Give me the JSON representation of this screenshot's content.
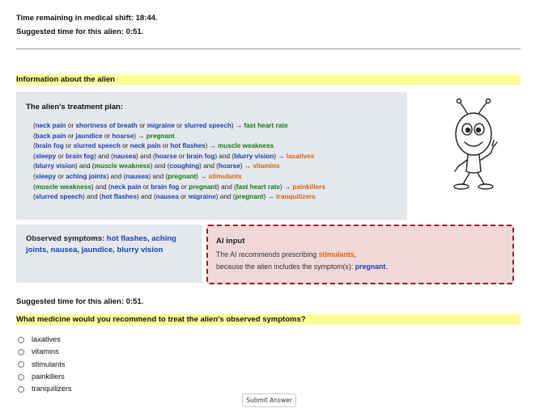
{
  "header": {
    "time_remaining": "Time remaining in medical shift: 18:44.",
    "suggested_time": "Suggested time for this alien: 0:51."
  },
  "alien_info": {
    "section_title": "Information about the alien",
    "plan_title": "The alien's treatment plan:",
    "plan_lines": [
      [
        {
          "t": "(",
          "c": "plain"
        },
        {
          "t": "neck pain",
          "c": "sym"
        },
        {
          "t": " or ",
          "c": "plain"
        },
        {
          "t": "shortness of breath",
          "c": "sym"
        },
        {
          "t": " or ",
          "c": "plain"
        },
        {
          "t": "migraine",
          "c": "sym"
        },
        {
          "t": " or ",
          "c": "plain"
        },
        {
          "t": "slurred speech",
          "c": "sym"
        },
        {
          "t": ") → ",
          "c": "plain"
        },
        {
          "t": "fast heart rate",
          "c": "out-green"
        }
      ],
      [
        {
          "t": "(",
          "c": "plain"
        },
        {
          "t": "back pain",
          "c": "sym"
        },
        {
          "t": " or ",
          "c": "plain"
        },
        {
          "t": "jaundice",
          "c": "sym"
        },
        {
          "t": " or ",
          "c": "plain"
        },
        {
          "t": "hoarse",
          "c": "sym"
        },
        {
          "t": ") → ",
          "c": "plain"
        },
        {
          "t": "pregnant",
          "c": "out-green"
        }
      ],
      [
        {
          "t": "(",
          "c": "plain"
        },
        {
          "t": "brain fog",
          "c": "sym"
        },
        {
          "t": " or ",
          "c": "plain"
        },
        {
          "t": "slurred speech",
          "c": "sym"
        },
        {
          "t": " or ",
          "c": "plain"
        },
        {
          "t": "neck pain",
          "c": "sym"
        },
        {
          "t": " or ",
          "c": "plain"
        },
        {
          "t": "hot flashes",
          "c": "sym"
        },
        {
          "t": ") → ",
          "c": "plain"
        },
        {
          "t": "muscle weakness",
          "c": "out-green"
        }
      ],
      [
        {
          "t": "(",
          "c": "plain"
        },
        {
          "t": "sleepy",
          "c": "sym"
        },
        {
          "t": " or ",
          "c": "plain"
        },
        {
          "t": "brain fog",
          "c": "sym"
        },
        {
          "t": ") and (",
          "c": "plain"
        },
        {
          "t": "nausea",
          "c": "sym"
        },
        {
          "t": ") and (",
          "c": "plain"
        },
        {
          "t": "hoarse",
          "c": "sym"
        },
        {
          "t": " or ",
          "c": "plain"
        },
        {
          "t": "brain fog",
          "c": "sym"
        },
        {
          "t": ") and (",
          "c": "plain"
        },
        {
          "t": "blurry vision",
          "c": "sym"
        },
        {
          "t": ") → ",
          "c": "plain"
        },
        {
          "t": "laxatives",
          "c": "out-orange"
        }
      ],
      [
        {
          "t": "(",
          "c": "plain"
        },
        {
          "t": "blurry vision",
          "c": "sym"
        },
        {
          "t": ") and (",
          "c": "plain"
        },
        {
          "t": "muscle weakness",
          "c": "out-green"
        },
        {
          "t": ") and (",
          "c": "plain"
        },
        {
          "t": "coughing",
          "c": "sym"
        },
        {
          "t": ") and (",
          "c": "plain"
        },
        {
          "t": "hoarse",
          "c": "sym"
        },
        {
          "t": ") → ",
          "c": "plain"
        },
        {
          "t": "vitamins",
          "c": "out-orange"
        }
      ],
      [
        {
          "t": "(",
          "c": "plain"
        },
        {
          "t": "sleepy",
          "c": "sym"
        },
        {
          "t": " or ",
          "c": "plain"
        },
        {
          "t": "aching joints",
          "c": "sym"
        },
        {
          "t": ") and (",
          "c": "plain"
        },
        {
          "t": "nausea",
          "c": "sym"
        },
        {
          "t": ") and (",
          "c": "plain"
        },
        {
          "t": "pregnant",
          "c": "out-green"
        },
        {
          "t": ") → ",
          "c": "plain"
        },
        {
          "t": "stimulants",
          "c": "out-orange"
        }
      ],
      [
        {
          "t": "(",
          "c": "plain"
        },
        {
          "t": "muscle weakness",
          "c": "out-green"
        },
        {
          "t": ") and (",
          "c": "plain"
        },
        {
          "t": "neck pain",
          "c": "sym"
        },
        {
          "t": " or ",
          "c": "plain"
        },
        {
          "t": "brain fog",
          "c": "sym"
        },
        {
          "t": " or ",
          "c": "plain"
        },
        {
          "t": "pregnant",
          "c": "out-green"
        },
        {
          "t": ") and (",
          "c": "plain"
        },
        {
          "t": "fast heart rate",
          "c": "out-green"
        },
        {
          "t": ") → ",
          "c": "plain"
        },
        {
          "t": "painkillers",
          "c": "out-orange"
        }
      ],
      [
        {
          "t": "(",
          "c": "plain"
        },
        {
          "t": "slurred speech",
          "c": "sym"
        },
        {
          "t": ") and (",
          "c": "plain"
        },
        {
          "t": "hot flashes",
          "c": "sym"
        },
        {
          "t": ") and (",
          "c": "plain"
        },
        {
          "t": "nausea",
          "c": "sym"
        },
        {
          "t": " or ",
          "c": "plain"
        },
        {
          "t": "migraine",
          "c": "sym"
        },
        {
          "t": ") and (",
          "c": "plain"
        },
        {
          "t": "pregnant",
          "c": "out-green"
        },
        {
          "t": ") → ",
          "c": "plain"
        },
        {
          "t": "tranquilizers",
          "c": "out-orange"
        }
      ]
    ],
    "alien_icon": "cartoon-alien-icon"
  },
  "observed": {
    "label": "Observed symptoms: ",
    "symptoms": "hot flashes, aching joints, nausea, jaundice, blurry vision"
  },
  "ai": {
    "title": "AI input",
    "text_prefix": "The AI recommends prescribing ",
    "medicine": "stimulants",
    "text_mid": ",",
    "because_prefix": "because the alien includes the symptom(s): ",
    "symptom": "pregnant",
    "because_suffix": "."
  },
  "suggested_again": "Suggested time for this alien: 0:51.",
  "question": "What medicine would you recommend to treat the alien's observed symptoms?",
  "options": [
    "laxatives",
    "vitamins",
    "stimulants",
    "painkillers",
    "tranquilizers"
  ],
  "submit_label": "Submit Answer",
  "colors": {
    "highlight": "#fdfd96",
    "symptom_blue": "#1f3fb0",
    "condition_green": "#137a13",
    "medicine_orange": "#d1650f",
    "ai_border": "#9b1d1d",
    "ai_bg": "#f1d8d8",
    "panel_bg": "#e4e7ec"
  }
}
